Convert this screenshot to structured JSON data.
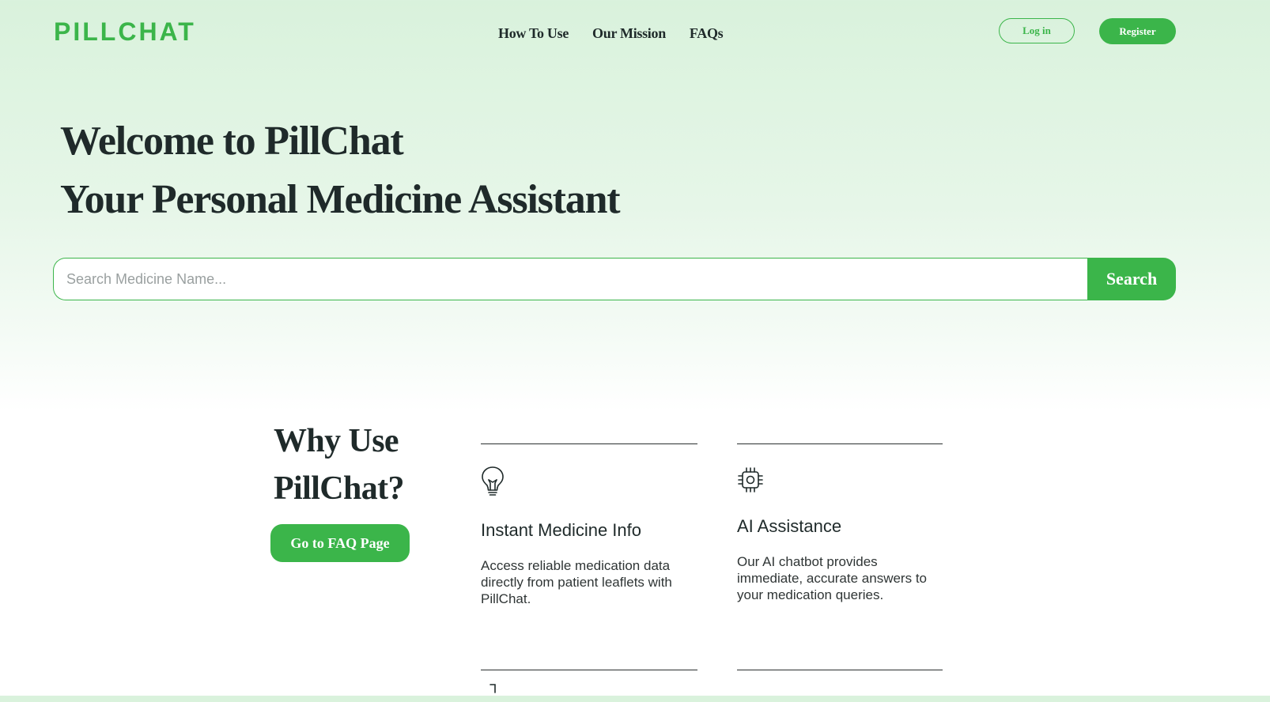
{
  "header": {
    "logo": "PILLCHAT",
    "nav": [
      "How To Use",
      "Our Mission",
      "FAQs"
    ],
    "login_label": "Log in",
    "register_label": "Register"
  },
  "hero": {
    "title_line1": "Welcome to PillChat",
    "title_line2": "Your Personal Medicine Assistant",
    "search_placeholder": "Search Medicine Name...",
    "search_value": "",
    "search_button": "Search"
  },
  "why": {
    "title_line1": "Why Use",
    "title_line2": "PillChat?",
    "faq_button": "Go to FAQ Page",
    "features": [
      {
        "icon": "lightbulb-icon",
        "title": "Instant Medicine Info",
        "description": "Access reliable medication data directly from patient leaflets with PillChat."
      },
      {
        "icon": "chip-icon",
        "title": "AI Assistance",
        "description": "Our AI chatbot provides immediate, accurate answers to your medication queries."
      }
    ]
  },
  "colors": {
    "brand_green": "#3bb54a",
    "text_dark": "#1f2a2a",
    "background_top": "#d9f2dc"
  }
}
